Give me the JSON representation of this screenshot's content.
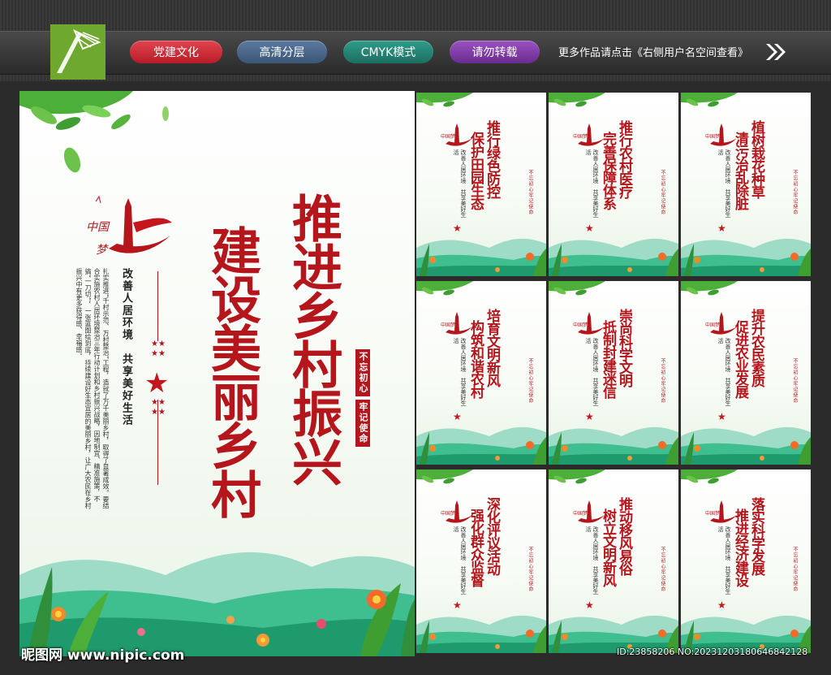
{
  "header": {
    "tags": [
      "党建文化",
      "高清分层",
      "CMYK模式",
      "请勿转载"
    ],
    "tag_colors": [
      "#c8202c",
      "#4a6a90",
      "#23887a",
      "#84409f"
    ],
    "more_link": "更多作品请点击《右侧用户名空间查看》",
    "logo_icon": "pen-nib-icon",
    "arrow_icon": "double-chevron-right-icon"
  },
  "main_poster": {
    "title_line1": "推进乡村振兴",
    "title_line2": "建设美丽乡村",
    "logo_text": "中国梦",
    "slogan": "改善人居环境　共享美好生活",
    "motto_seals": [
      "不忘初心",
      "牢记使命"
    ],
    "paragraph": "扎实推进“千村示范、万村整治”工程，造就了万千美丽乡村，取得了显著成效。要结合实施农村人居环境整治三年行动计划和乡村振兴战略，因地制宜、精准施策，不搞“一刀切”，一张蓝图绘到底，持续建设好生态宜居的美丽乡村，让广大农民在乡村振兴中有更多获得感、幸福感。"
  },
  "small_posters": [
    {
      "line1": "推行绿色防控",
      "line2": "保护田园生态"
    },
    {
      "line1": "推行农村医疗",
      "line2": "完善保障体系"
    },
    {
      "line1": "植树栽花种草",
      "line2": "清污治乱除脏"
    },
    {
      "line1": "培育文明新风",
      "line2": "构筑和谐农村"
    },
    {
      "line1": "崇尚科学文明",
      "line2": "抵制封建迷信"
    },
    {
      "line1": "提升农民素质",
      "line2": "促进农业发展"
    },
    {
      "line1": "深化评议活动",
      "line2": "强化群众监督"
    },
    {
      "line1": "推动移风易俗",
      "line2": "树立文明新风"
    },
    {
      "line1": "落实科学发展",
      "line2": "推进经济建设"
    }
  ],
  "small_common": {
    "motto": "改善人居环境　共享美好生活",
    "seal": "不忘初心牢记使命"
  },
  "watermark": {
    "site": "昵图网 www.nipic.com",
    "id": "ID:23858206 NO:20231203180646842128"
  }
}
